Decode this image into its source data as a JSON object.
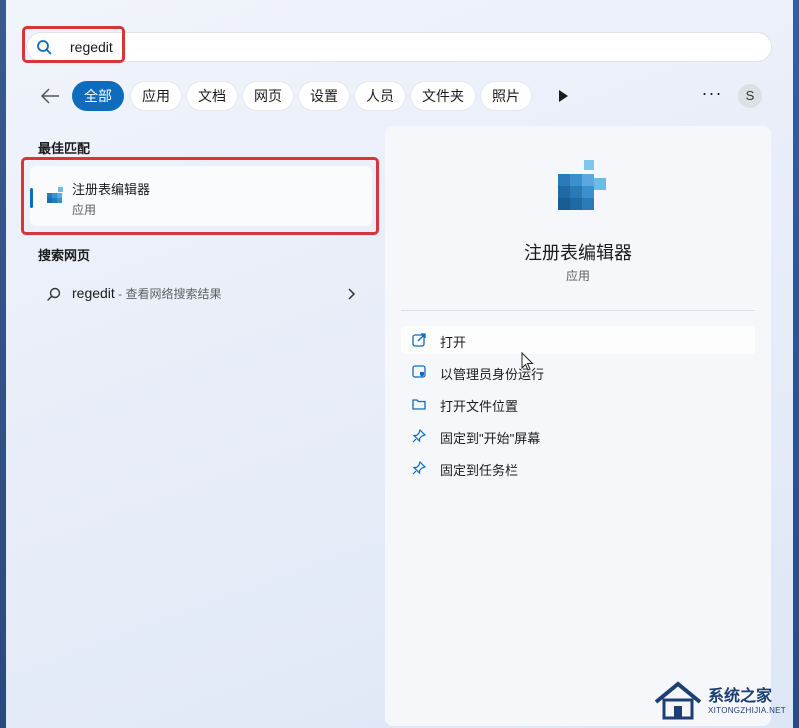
{
  "search": {
    "query": "regedit"
  },
  "filters": [
    "全部",
    "应用",
    "文档",
    "网页",
    "设置",
    "人员",
    "文件夹",
    "照片"
  ],
  "active_filter": "全部",
  "avatar_letter": "S",
  "best_match": {
    "heading": "最佳匹配",
    "name": "注册表编辑器",
    "type": "应用"
  },
  "web": {
    "heading": "搜索网页",
    "query": "regedit",
    "hint": " - 查看网络搜索结果"
  },
  "detail": {
    "name": "注册表编辑器",
    "type": "应用",
    "actions": [
      {
        "label": "打开",
        "icon": "open-external-icon"
      },
      {
        "label": "以管理员身份运行",
        "icon": "shield-admin-icon"
      },
      {
        "label": "打开文件位置",
        "icon": "folder-icon"
      },
      {
        "label": "固定到\"开始\"屏幕",
        "icon": "pin-icon"
      },
      {
        "label": "固定到任务栏",
        "icon": "pin-icon"
      }
    ]
  },
  "watermark": {
    "name": "系统之家",
    "url": "XITONGZHIJIA.NET"
  },
  "colors": {
    "accent": "#0f6cbd",
    "highlight": "#d8343a"
  }
}
